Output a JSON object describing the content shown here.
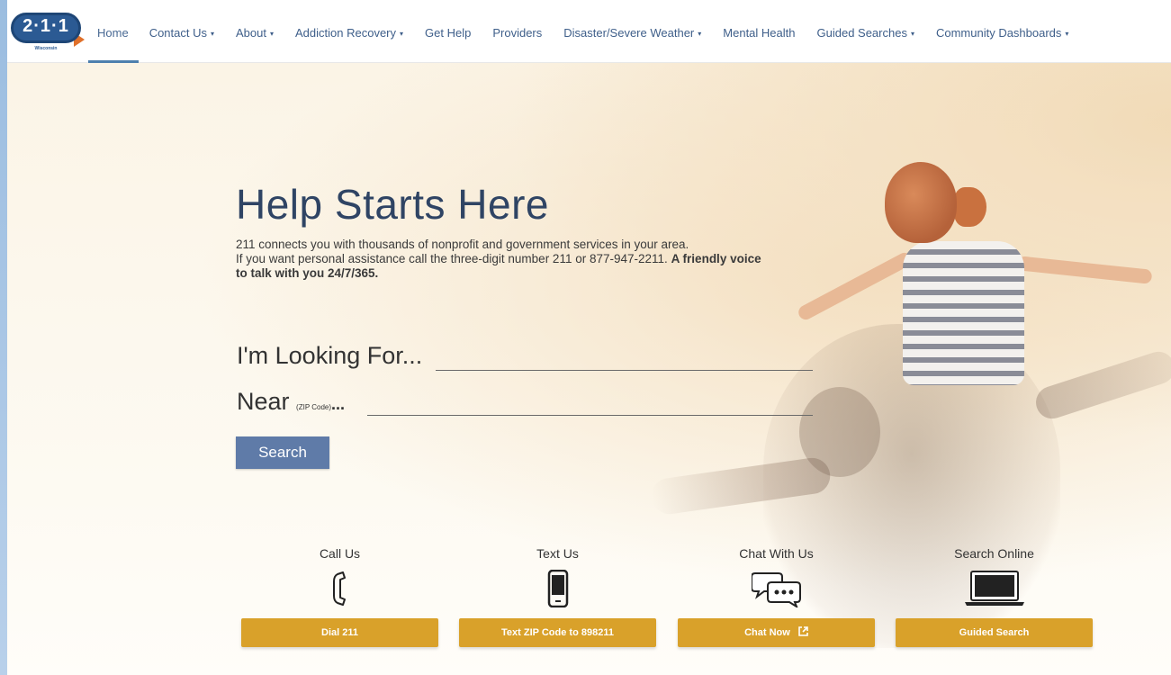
{
  "logo": {
    "text": "2·1·1",
    "subtext": "Wisconsin"
  },
  "nav": {
    "items": [
      {
        "label": "Home",
        "dropdown": false,
        "active": true
      },
      {
        "label": "Contact Us",
        "dropdown": true
      },
      {
        "label": "About",
        "dropdown": true
      },
      {
        "label": "Addiction Recovery",
        "dropdown": true
      },
      {
        "label": "Get Help",
        "dropdown": false
      },
      {
        "label": "Providers",
        "dropdown": false
      },
      {
        "label": "Disaster/Severe Weather",
        "dropdown": true
      },
      {
        "label": "Mental Health",
        "dropdown": false
      },
      {
        "label": "Guided Searches",
        "dropdown": true
      },
      {
        "label": "Community Dashboards",
        "dropdown": true
      }
    ],
    "caret": "▾"
  },
  "hero": {
    "title": "Help Starts Here",
    "desc_line1": "211 connects you with thousands of nonprofit and government services in your area.",
    "desc_line2": "If you want personal assistance call the three-digit number 211 or 877-947-2211.",
    "desc_bold": "A friendly voice to talk with you 24/7/365."
  },
  "search": {
    "looking_label": "I'm Looking For...",
    "looking_value": "",
    "near_label": "Near",
    "near_small": "(ZIP Code)",
    "near_dots": "...",
    "near_value": "",
    "button_label": "Search"
  },
  "contact": [
    {
      "title": "Call Us",
      "icon": "phone-icon",
      "button": "Dial 211"
    },
    {
      "title": "Text Us",
      "icon": "mobile-phone-icon",
      "button": "Text ZIP Code to 898211"
    },
    {
      "title": "Chat With Us",
      "icon": "chat-bubbles-icon",
      "button": "Chat Now"
    },
    {
      "title": "Search Online",
      "icon": "laptop-icon",
      "button": "Guided Search"
    }
  ],
  "colors": {
    "brand_blue": "#2b5a93",
    "nav_text": "#3f5f8a",
    "search_button": "#5f7ba8",
    "contact_button": "#d9a12a",
    "title_text": "#2f4464"
  }
}
